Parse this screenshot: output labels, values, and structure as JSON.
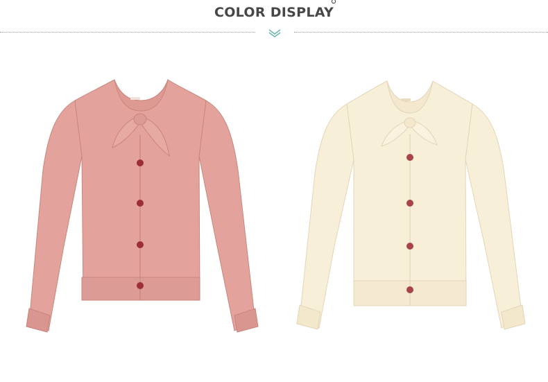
{
  "header": {
    "title": "COLOR DISPLAY",
    "title_mark_icon": "small-circle-icon",
    "divider_icon": "double-chevron-down-icon",
    "accent_color": "#6fb6b2"
  },
  "products": [
    {
      "color_name": "pink",
      "body_color": "#e3a39c",
      "shade_color": "#c9857e",
      "button_color": "#9b2e36"
    },
    {
      "color_name": "cream",
      "body_color": "#f8efd9",
      "shade_color": "#e2d6b9",
      "button_color": "#a8434a"
    }
  ]
}
